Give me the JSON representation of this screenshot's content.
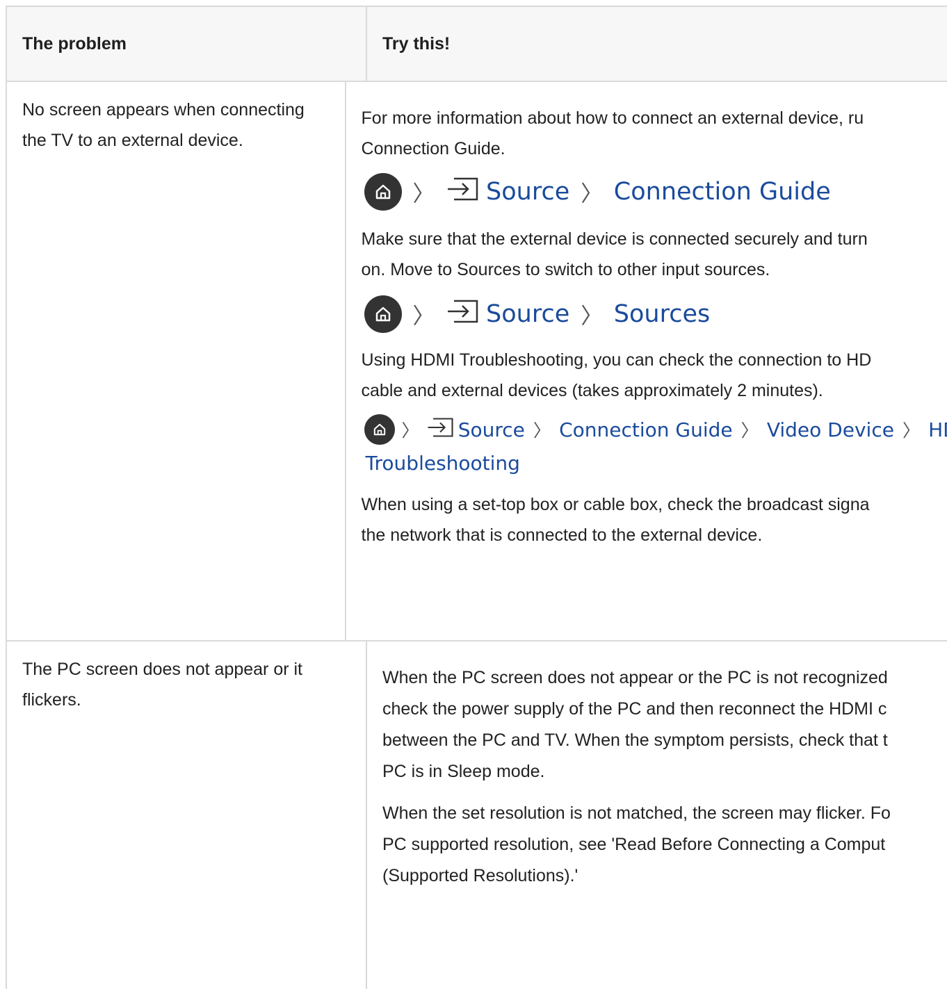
{
  "table": {
    "header": {
      "problem": "The problem",
      "solution": "Try this!"
    },
    "row1": {
      "problem_line1": "No screen appears when connecting",
      "problem_line2": "the TV to an external device.",
      "p1_line1": "For more information about how to connect an external device, ru",
      "p1_line2": "Connection Guide.",
      "path1": {
        "source": "Source",
        "target": "Connection Guide"
      },
      "p2_line1": "Make sure that the external device is connected securely and turn",
      "p2_line2": "on. Move to Sources to switch to other input sources.",
      "path2": {
        "source": "Source",
        "target": "Sources"
      },
      "p3_line1": "Using HDMI Troubleshooting, you can check the connection to HD",
      "p3_line2": "cable and external devices (takes approximately 2 minutes).",
      "path3": {
        "source": "Source",
        "step1": "Connection Guide",
        "step2": "Video Device",
        "step3": "HDI",
        "continuation": "Troubleshooting"
      },
      "p4_line1": "When using a set-top box or cable box, check the broadcast signa",
      "p4_line2": "the network that is connected to the external device."
    },
    "row2": {
      "problem_line1": "The PC screen does not appear or it",
      "problem_line2": "flickers.",
      "p1_line1": "When the PC screen does not appear or the PC is not recognized",
      "p1_line2": "check the power supply of the PC and then reconnect the HDMI c",
      "p1_line3": "between the PC and TV. When the symptom persists, check that t",
      "p1_line4": "PC is in Sleep mode.",
      "p2_line1": "When the set resolution is not matched, the screen may flicker. Fo",
      "p2_line2": "PC supported resolution, see 'Read Before Connecting a Comput",
      "p2_line3": "(Supported Resolutions).'"
    }
  },
  "icons": {
    "home": "home-icon",
    "source": "source-input-icon",
    "separator": "chevron-right-icon"
  },
  "colors": {
    "link": "#1a4b9c",
    "border": "#dadada",
    "header_bg": "#f7f7f7",
    "text": "#222222"
  }
}
